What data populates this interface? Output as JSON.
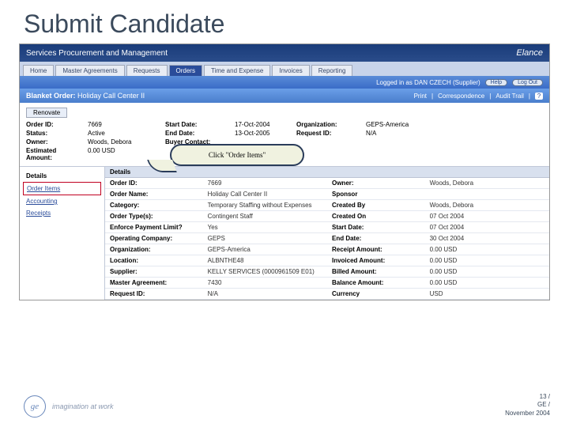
{
  "slide_title": "Submit Candidate",
  "app": {
    "title": "Services Procurement and Management",
    "brand": "Elance"
  },
  "tabs": [
    "Home",
    "Master Agreements",
    "Requests",
    "Orders",
    "Time and Expense",
    "Invoices",
    "Reporting"
  ],
  "active_tab": 3,
  "logged_in": "Logged in as DAN CZECH (Supplier)",
  "sub_buttons": {
    "help": "Help",
    "logout": "Log Out"
  },
  "order_bar": {
    "title_label": "Blanket Order:",
    "title_value": "Holiday Call Center II",
    "links": [
      "Print",
      "Correspondence",
      "Audit Trail"
    ]
  },
  "renovate_btn": "Renovate",
  "summary": {
    "order_id_l": "Order ID:",
    "order_id_v": "7669",
    "status_l": "Status:",
    "status_v": "Active",
    "owner_l": "Owner:",
    "owner_v": "Woods, Debora",
    "est_l": "Estimated Amount:",
    "est_v": "0.00 USD",
    "start_l": "Start Date:",
    "start_v": "17-Oct-2004",
    "end_l": "End Date:",
    "end_v": "13-Oct-2005",
    "buyer_l": "Buyer Contact:",
    "org_l": "Organization:",
    "org_v": "GEPS-America",
    "req_l": "Request ID:",
    "req_v": "N/A"
  },
  "callout": "Click \"Order Items\"",
  "side_nav": {
    "details": "Details",
    "order_items": "Order Items",
    "accounting": "Accounting",
    "receipts": "Receipts"
  },
  "details_header": "Details",
  "details_rows": [
    {
      "l1": "Order ID:",
      "v1": "7669",
      "l2": "Owner:",
      "v2": "Woods, Debora"
    },
    {
      "l1": "Order Name:",
      "v1": "Holiday Call Center II",
      "l2": "Sponsor",
      "v2": ""
    },
    {
      "l1": "Category:",
      "v1": "Temporary Staffing without Expenses",
      "l2": "Created By",
      "v2": "Woods, Debora"
    },
    {
      "l1": "Order Type(s):",
      "v1": "Contingent Staff",
      "l2": "Created On",
      "v2": "07 Oct 2004"
    },
    {
      "l1": "Enforce Payment Limit?",
      "v1": "Yes",
      "l2": "Start Date:",
      "v2": "07 Oct 2004"
    },
    {
      "l1": "Operating Company:",
      "v1": "GEPS",
      "l2": "End Date:",
      "v2": "30 Oct 2004"
    },
    {
      "l1": "Organization:",
      "v1": "GEPS-America",
      "l2": "Receipt Amount:",
      "v2": "0.00 USD"
    },
    {
      "l1": "Location:",
      "v1": "ALBNTHE48",
      "l2": "Invoiced Amount:",
      "v2": "0.00 USD"
    },
    {
      "l1": "Supplier:",
      "v1": "KELLY SERVICES (0000961509 E01)",
      "l2": "Billed Amount:",
      "v2": "0.00 USD"
    },
    {
      "l1": "Master Agreement:",
      "v1": "7430",
      "l2": "Balance Amount:",
      "v2": "0.00 USD"
    },
    {
      "l1": "Request ID:",
      "v1": "N/A",
      "l2": "Currency",
      "v2": "USD"
    }
  ],
  "footer": {
    "logo_text": "ge",
    "tagline": "imagination at work",
    "page": "13 /",
    "ge": "GE /",
    "date": "November 2004"
  }
}
